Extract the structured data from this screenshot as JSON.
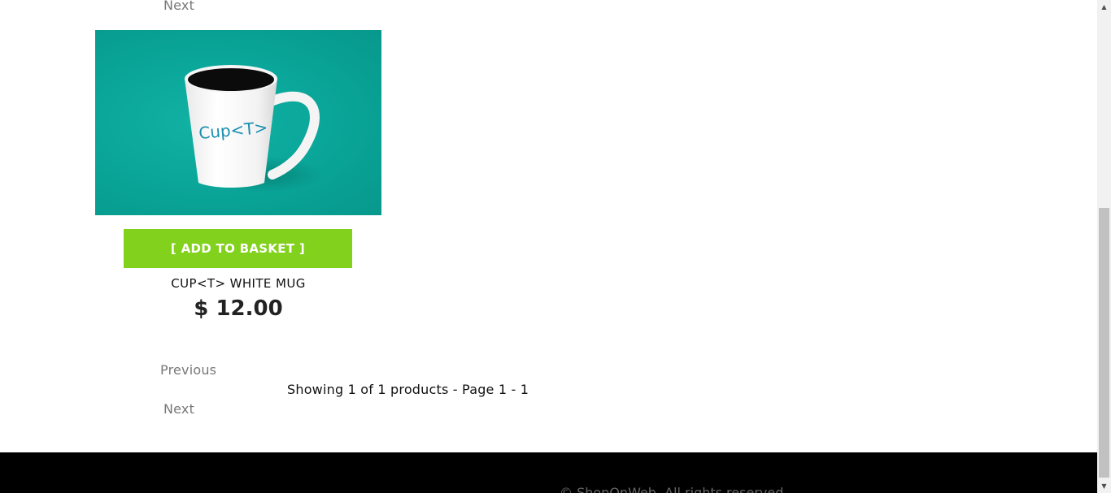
{
  "pagination": {
    "previous_label": "Previous",
    "next_label": "Next",
    "showing_text": "Showing 1 of 1 products - Page 1 - 1"
  },
  "product": {
    "image_alt": "Cup<T> white mug on teal background",
    "mug_text": "Cup<T>",
    "add_button_label": "[ ADD TO BASKET ]",
    "name": "CUP<T> WHITE MUG",
    "price": "$ 12.00"
  },
  "footer": {
    "copyright": "© ShopOnWeb. All rights reserved."
  },
  "colors": {
    "add_button": "#82d11c",
    "image_background": "#0aa79a",
    "footer_background": "#000000"
  },
  "icons": {
    "scroll_up": "scroll-up-arrow-icon",
    "scroll_down": "scroll-down-arrow-icon"
  }
}
